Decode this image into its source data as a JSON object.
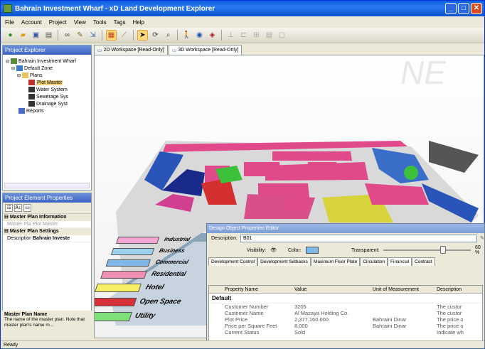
{
  "window": {
    "title": "Bahrain Investment Wharf - xD Land Development Explorer"
  },
  "menu": [
    "File",
    "Account",
    "Project",
    "View",
    "Tools",
    "Tags",
    "Help"
  ],
  "explorer": {
    "title": "Project Explorer",
    "nodes": [
      {
        "label": "Bahrain Investment Wharf",
        "indent": 0,
        "icon": "project-icon"
      },
      {
        "label": "Default Zone",
        "indent": 1,
        "icon": "zone-icon"
      },
      {
        "label": "Plans",
        "indent": 2,
        "icon": "folder-icon"
      },
      {
        "label": "Plot Master",
        "indent": 3,
        "icon": "plan-icon",
        "selected": true
      },
      {
        "label": "Water System",
        "indent": 3,
        "icon": "plan-icon"
      },
      {
        "label": "Sewerage Sys",
        "indent": 3,
        "icon": "plan-icon"
      },
      {
        "label": "Drainage Syst",
        "indent": 3,
        "icon": "plan-icon"
      },
      {
        "label": "Reports",
        "indent": 1,
        "icon": "reports-icon"
      }
    ]
  },
  "properties": {
    "title": "Project Element Properties",
    "cat1": "Master Plan Information",
    "row1": {
      "key": "Master Plan",
      "value": "Plot Master"
    },
    "cat2": "Master Plan Settings",
    "row2": {
      "key": "Description",
      "value": "Bahrain Investe"
    }
  },
  "help": {
    "title": "Master Plan Name",
    "text": "The name of the master plan. Note that master plan's name m..."
  },
  "tabs": [
    "2D Workspace [Read-Only]",
    "3D Workspace [Read-Only]"
  ],
  "legend": [
    "Industrial",
    "Business",
    "Commercial",
    "Residential",
    "Hotel",
    "Open Space",
    "Utility"
  ],
  "legend_colors": [
    "#f3a6d4",
    "#9ed0f0",
    "#7fb7e8",
    "#ef8fb4",
    "#f4ef63",
    "#d6303b",
    "#7fe07a"
  ],
  "editor": {
    "title": "Design Object Properties Editor",
    "description_label": "Description:",
    "description_value": "B01",
    "visibility_label": "Visibility:",
    "color_label": "Color:",
    "color_value": "#7bb8ec",
    "transparent_label": "Transparent:",
    "transparent_value": "60 %",
    "tabs": [
      "Development Control",
      "Development Setbacks",
      "Maximum Floor Plate",
      "Circulation",
      "Financial",
      "Contract"
    ],
    "active_tab": "Financial",
    "columns": [
      "Property Name",
      "Value",
      "Unit of Measurement",
      "Description"
    ],
    "group": "Default",
    "rows": [
      [
        "Customer Number",
        "3205",
        "",
        "The custor"
      ],
      [
        "Customer Name",
        "Al Mazaya Holding Co.",
        "",
        "The custor"
      ],
      [
        "Plot Price",
        "2,377,160.000",
        "Bahraini Dinar",
        "The price o"
      ],
      [
        "Price per Square Feet",
        "8.000",
        "Bahraini Dinar",
        "The price o"
      ],
      [
        "Current Status",
        "Sold",
        "",
        "Indicate wh"
      ]
    ]
  },
  "status": "Ready"
}
